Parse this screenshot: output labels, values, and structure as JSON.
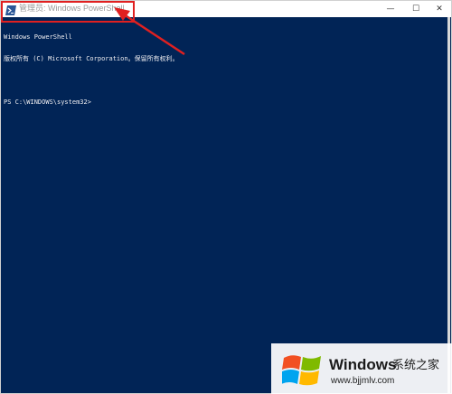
{
  "window": {
    "title": "管理员: Windows PowerShell",
    "controls": {
      "minimize": "—",
      "maximize": "☐",
      "close": "✕"
    },
    "background_color": "#012456",
    "text_color": "#eeedf0"
  },
  "console": {
    "lines": [
      "Windows PowerShell",
      "版权所有 (C) Microsoft Corporation。保留所有权利。",
      "",
      "PS C:\\WINDOWS\\system32>"
    ]
  },
  "annotation": {
    "color": "#e02020"
  },
  "watermark": {
    "brand": "Windows",
    "site_name": "系统之家",
    "url": "www.bjjmlv.com"
  },
  "icons": {
    "app": "powershell-icon",
    "logo": "windows-logo-icon"
  }
}
